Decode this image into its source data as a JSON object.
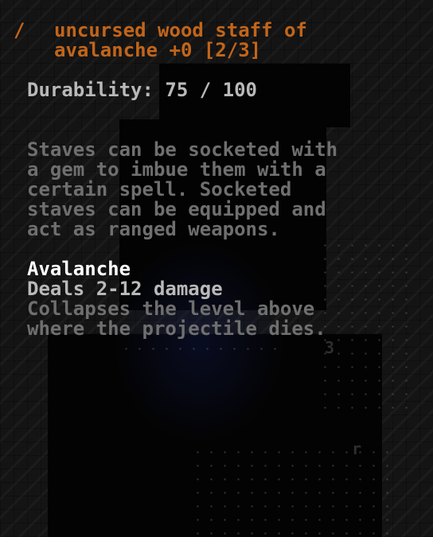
{
  "item": {
    "glyph": "/",
    "name_line1": "uncursed wood staff of",
    "name_line2": "avalanche +0 [2/3]"
  },
  "durability": "Durability: 75 / 100",
  "description": [
    "Staves can be socketed with",
    "a gem to imbue them with a",
    "certain spell. Socketed",
    "staves can be equipped and",
    "act as ranged weapons."
  ],
  "spell": {
    "name": "Avalanche",
    "damage": "Deals 2-12 damage",
    "effect": [
      "Collapses the level above",
      "where the projectile dies."
    ]
  },
  "map": {
    "glyph_3": "3",
    "glyph_r": "r"
  },
  "colors": {
    "item_name": "#c2651a",
    "durability": "#b9b9b9",
    "description": "#6f6f6f",
    "spell_name": "#ffffff"
  }
}
